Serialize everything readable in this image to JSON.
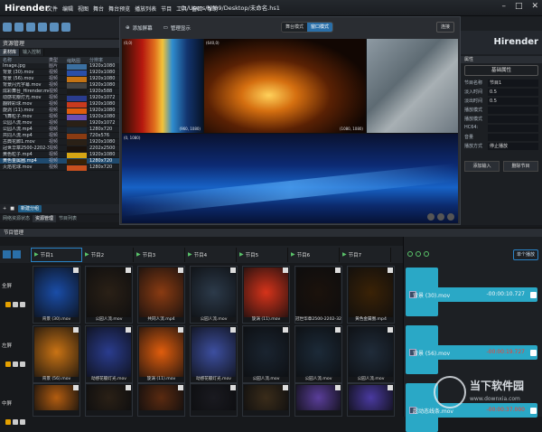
{
  "app": {
    "name": "Hirender",
    "filepath": "C:/Users/lyf09/Desktop/未命名.hs1"
  },
  "menu": [
    "文件",
    "编辑",
    "视图",
    "舞台",
    "舞台预览",
    "播放列表",
    "节目",
    "工具",
    "窗口",
    "帮助"
  ],
  "resources": {
    "title": "资源管理",
    "tabs": [
      "素材库",
      "输入控制"
    ],
    "columns": [
      "名称",
      "类型",
      "缩略图",
      "分辨率"
    ],
    "items": [
      {
        "name": "Image.jpg",
        "type": "图片",
        "res": "1920x1080"
      },
      {
        "name": "背景 (30).mov",
        "type": "视频",
        "res": "1920x1080"
      },
      {
        "name": "背景 (56).mov",
        "type": "视频",
        "res": "1920x1080"
      },
      {
        "name": "背景闪光字幕.mov",
        "type": "视频",
        "res": "1920x1080"
      },
      {
        "name": "炫彩舞台_Hirender.mov",
        "type": "视频",
        "res": "1920x588"
      },
      {
        "name": "动感花瓣灯光.mov",
        "type": "视频",
        "res": "1920x1072"
      },
      {
        "name": "翻转彩球.mov",
        "type": "视频",
        "res": "1920x1080"
      },
      {
        "name": "旋涡 (11).mov",
        "type": "视频",
        "res": "1920x1080"
      },
      {
        "name": "飞舞粒子.mov",
        "type": "视频",
        "res": "1920x1080"
      },
      {
        "name": "公园人流.mov",
        "type": "视频",
        "res": "1920x1072"
      },
      {
        "name": "公园人流.mp4",
        "type": "视频",
        "res": "1280x720"
      },
      {
        "name": "共同人流.mp4",
        "type": "视频",
        "res": "720x576"
      },
      {
        "name": "古典花廊1.mov",
        "type": "视频",
        "res": "1920x1080"
      },
      {
        "name": "冠世华章2500-2202-32...",
        "type": "视频",
        "res": "2202x2500"
      },
      {
        "name": "黄色粒子.mp4",
        "type": "视频",
        "res": "1920x1080"
      },
      {
        "name": "黄色金属圈.mp4",
        "type": "视频",
        "res": "1280x720"
      },
      {
        "name": "火焰花球.mov",
        "type": "视频",
        "res": "1280x720"
      }
    ],
    "footer_button": "新建分组",
    "bottom_tabs": [
      "网络资源状态",
      "资源管理",
      "节目列表"
    ]
  },
  "preview": {
    "add_screen": "添加屏幕",
    "manage_screens": "管理显示",
    "mode_stage": "舞台模式",
    "mode_window": "窗口模式",
    "connect": "连接",
    "labels": {
      "v1": "(0,0)",
      "v2": "(640,0)",
      "v1_size": "(960, 1080)",
      "v2_size": "(1080, 1080)",
      "v4": "(0, 1080)"
    }
  },
  "properties": {
    "brand": "Hirender",
    "title": "属性",
    "tab": "基础属性",
    "rows": [
      {
        "k": "节目名称",
        "v": "节目1"
      },
      {
        "k": "淡入时间",
        "v": "0.5"
      },
      {
        "k": "淡出时间",
        "v": "0.5"
      },
      {
        "k": "播放模式",
        "v": ""
      },
      {
        "k": "播放模式",
        "v": ""
      },
      {
        "k": "HC64:",
        "v": ""
      },
      {
        "k": "音量",
        "v": ""
      },
      {
        "k": "播放方式",
        "v": "停止播放"
      }
    ],
    "buttons": [
      "添加输入",
      "删除节目"
    ]
  },
  "cues": {
    "title": "节目管理",
    "tabs": [
      "节目1",
      "节目2",
      "节目3",
      "节目4",
      "节目5",
      "节目6",
      "节目7"
    ],
    "rows": [
      {
        "label": "全屏",
        "items": [
          {
            "cap": "背景 (30).mov",
            "c": "#1a4da8"
          },
          {
            "cap": "公园人流.mov",
            "c": "#2a2016"
          },
          {
            "cap": "共同人流.mp4",
            "c": "#8a3b12"
          },
          {
            "cap": "公园人流.mov",
            "c": "#2c3a4a"
          },
          {
            "cap": "旋涡 (11).mov",
            "c": "#d6331a"
          },
          {
            "cap": "冠世华章2500-2202-32...",
            "c": "#1b120c"
          },
          {
            "cap": "黄色金属圈.mp4",
            "c": "#3a2206"
          }
        ]
      },
      {
        "label": "左屏",
        "items": [
          {
            "cap": "背景 (56).mov",
            "c": "#c97314"
          },
          {
            "cap": "动感花瓣灯光.mov",
            "c": "#2a3c8e"
          },
          {
            "cap": "旋涡 (11).mov",
            "c": "#e05d0d"
          },
          {
            "cap": "动感花瓣灯光.mov",
            "c": "#3d4fa0"
          },
          {
            "cap": "公园人流.mov",
            "c": "#1a2430"
          },
          {
            "cap": "公园人流.mov",
            "c": "#1c2a38"
          },
          {
            "cap": "公园人流.mov",
            "c": "#202c3a"
          }
        ]
      },
      {
        "label": "中屏",
        "items": [
          {
            "cap": "",
            "c": "#b35d10"
          },
          {
            "cap": "",
            "c": "#2a2016"
          },
          {
            "cap": "",
            "c": "#5a2a10"
          },
          {
            "cap": "",
            "c": "#1a1a20"
          },
          {
            "cap": "",
            "c": "#3a2c1a"
          },
          {
            "cap": "",
            "c": "#5a3e9a"
          },
          {
            "cap": "",
            "c": "#4a3aa0"
          }
        ]
      }
    ]
  },
  "playlist": {
    "mode_button": "单个播放",
    "items": [
      {
        "name": "背景 (30).mov",
        "time": "-00:00:10.727",
        "red": false
      },
      {
        "name": "背景 (56).mov",
        "time": "-00:00:19.727",
        "red": true
      },
      {
        "name": "超动态线条.mov",
        "time": "-00:00:37.000",
        "red": true
      }
    ]
  },
  "watermark": {
    "title": "当下软件园",
    "url": "www.downxia.com"
  }
}
